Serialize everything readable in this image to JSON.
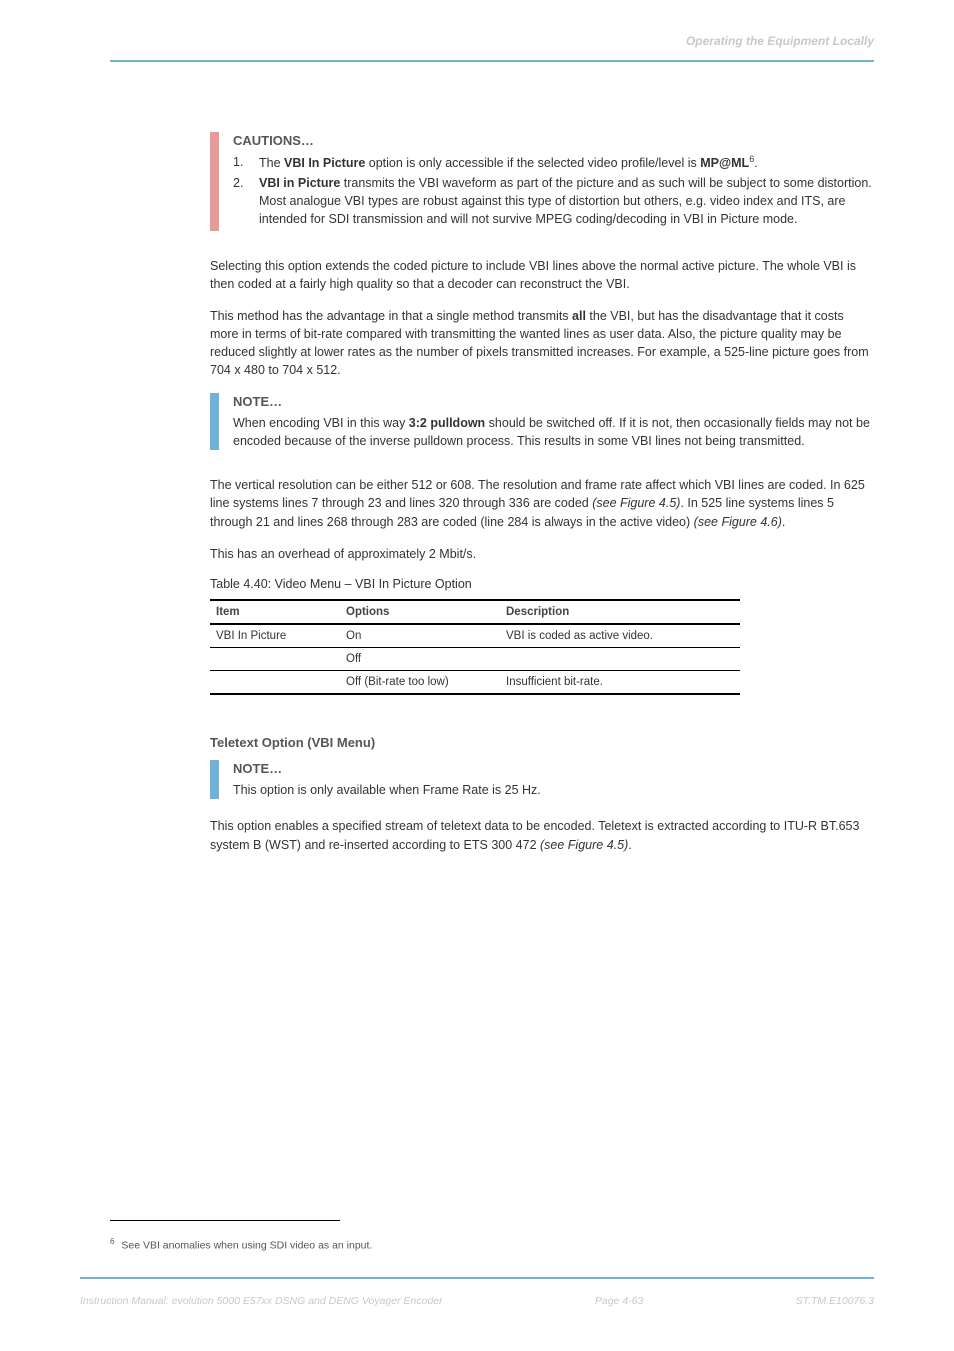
{
  "header": {
    "right": "Operating the Equipment Locally"
  },
  "cautions": {
    "title": "CAUTIONS…",
    "items": [
      {
        "num": "1.",
        "pre": "The ",
        "bold1": "VBI In Picture",
        "mid": " option is only accessible if the selected video profile/level is ",
        "bold2": "MP@ML",
        "sup": "6",
        "post": "."
      },
      {
        "num": "2.",
        "bold1": "VBI in Picture",
        "text": " transmits the VBI waveform as part of the picture and as such will be subject to some distortion. Most analogue VBI types are robust against this type of distortion but others, e.g. video index and ITS, are intended for SDI transmission and will not survive MPEG coding/decoding in VBI in Picture mode."
      }
    ]
  },
  "body": {
    "p1": "Selecting this option extends the coded picture to include VBI lines above the normal active picture. The whole VBI is then coded at a fairly high quality so that a decoder can reconstruct the VBI.",
    "p2_a": "This method has the advantage in that a single method transmits ",
    "p2_bold": "all",
    "p2_b": " the VBI, but has the disadvantage that it costs more in terms of bit-rate compared with transmitting the wanted lines as user data. Also, the picture quality may be reduced slightly at lower rates as the number of pixels transmitted increases. For example, a 525-line picture goes from 704 x 480 to 704 x 512."
  },
  "note1": {
    "title": "NOTE…",
    "pre": "When encoding VBI in this way ",
    "bold": "3:2 pulldown",
    "post": " should be switched off. If it is not, then occasionally fields may not be encoded because of the inverse pulldown process. This results in some VBI lines not being transmitted."
  },
  "body2": {
    "p3_a": "The vertical resolution can be either 512 or 608. The resolution and frame rate affect which VBI lines are coded. In 625 line systems lines 7 through 23 and lines 320 through 336 are coded ",
    "p3_i": "(see Figure 4.5)",
    "p3_b": ". In 525 line systems lines 5 through 21 and lines 268 through 283 are coded (line 284 is always in the active video) ",
    "p3_i2": "(see Figure 4.6)",
    "p3_c": ".",
    "p4": "This has an overhead of approximately 2 Mbit/s."
  },
  "table": {
    "caption": "Table 4.40: Video Menu – VBI In Picture Option",
    "headers": [
      "Item",
      "Options",
      "Description"
    ],
    "rows": [
      {
        "item": "VBI In Picture",
        "opt": "On",
        "desc": "VBI is coded as active video."
      },
      {
        "item": "",
        "opt": "Off",
        "desc": ""
      },
      {
        "item": "",
        "opt": "Off (Bit-rate too low)",
        "desc": "Insufficient  bit-rate."
      }
    ]
  },
  "section": {
    "heading": "Teletext Option (VBI Menu)",
    "note_title": "NOTE…",
    "note_text": "This option is only available when Frame Rate is 25 Hz.",
    "p_a": "This option enables a specified stream of teletext data to be encoded. Teletext is extracted according to ITU-R BT.653 system B (WST) and re-inserted according to ETS 300 472 ",
    "p_i": "(see Figure 4.5)",
    "p_b": "."
  },
  "footnote": {
    "num": "6",
    "text": " See VBI anomalies when using SDI video as an input."
  },
  "footer": {
    "left": "Instruction Manual: evolution 5000 E57xx DSNG and DENG Voyager Encoder",
    "center": "Page 4-63",
    "right": "ST.TM.E10076.3"
  }
}
